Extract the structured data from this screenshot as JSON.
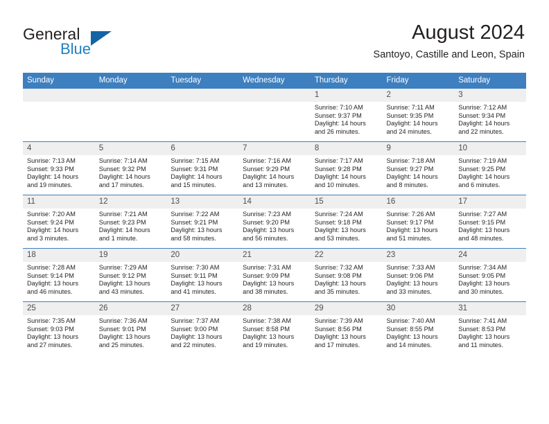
{
  "brand": {
    "name_part1": "General",
    "name_part2": "Blue",
    "logo_icon": "triangle-logo-icon",
    "accent_color": "#1f7fc4",
    "logo_color": "#1464a5"
  },
  "header": {
    "title": "August 2024",
    "location": "Santoyo, Castille and Leon, Spain"
  },
  "calendar": {
    "header_bg": "#3d7fbf",
    "daynum_bg": "#efefef",
    "weekday_headers": [
      "Sunday",
      "Monday",
      "Tuesday",
      "Wednesday",
      "Thursday",
      "Friday",
      "Saturday"
    ],
    "weeks": [
      [
        {
          "day": "",
          "sunrise": "",
          "sunset": "",
          "daylight_line1": "",
          "daylight_line2": ""
        },
        {
          "day": "",
          "sunrise": "",
          "sunset": "",
          "daylight_line1": "",
          "daylight_line2": ""
        },
        {
          "day": "",
          "sunrise": "",
          "sunset": "",
          "daylight_line1": "",
          "daylight_line2": ""
        },
        {
          "day": "",
          "sunrise": "",
          "sunset": "",
          "daylight_line1": "",
          "daylight_line2": ""
        },
        {
          "day": "1",
          "sunrise": "Sunrise: 7:10 AM",
          "sunset": "Sunset: 9:37 PM",
          "daylight_line1": "Daylight: 14 hours",
          "daylight_line2": "and 26 minutes."
        },
        {
          "day": "2",
          "sunrise": "Sunrise: 7:11 AM",
          "sunset": "Sunset: 9:35 PM",
          "daylight_line1": "Daylight: 14 hours",
          "daylight_line2": "and 24 minutes."
        },
        {
          "day": "3",
          "sunrise": "Sunrise: 7:12 AM",
          "sunset": "Sunset: 9:34 PM",
          "daylight_line1": "Daylight: 14 hours",
          "daylight_line2": "and 22 minutes."
        }
      ],
      [
        {
          "day": "4",
          "sunrise": "Sunrise: 7:13 AM",
          "sunset": "Sunset: 9:33 PM",
          "daylight_line1": "Daylight: 14 hours",
          "daylight_line2": "and 19 minutes."
        },
        {
          "day": "5",
          "sunrise": "Sunrise: 7:14 AM",
          "sunset": "Sunset: 9:32 PM",
          "daylight_line1": "Daylight: 14 hours",
          "daylight_line2": "and 17 minutes."
        },
        {
          "day": "6",
          "sunrise": "Sunrise: 7:15 AM",
          "sunset": "Sunset: 9:31 PM",
          "daylight_line1": "Daylight: 14 hours",
          "daylight_line2": "and 15 minutes."
        },
        {
          "day": "7",
          "sunrise": "Sunrise: 7:16 AM",
          "sunset": "Sunset: 9:29 PM",
          "daylight_line1": "Daylight: 14 hours",
          "daylight_line2": "and 13 minutes."
        },
        {
          "day": "8",
          "sunrise": "Sunrise: 7:17 AM",
          "sunset": "Sunset: 9:28 PM",
          "daylight_line1": "Daylight: 14 hours",
          "daylight_line2": "and 10 minutes."
        },
        {
          "day": "9",
          "sunrise": "Sunrise: 7:18 AM",
          "sunset": "Sunset: 9:27 PM",
          "daylight_line1": "Daylight: 14 hours",
          "daylight_line2": "and 8 minutes."
        },
        {
          "day": "10",
          "sunrise": "Sunrise: 7:19 AM",
          "sunset": "Sunset: 9:25 PM",
          "daylight_line1": "Daylight: 14 hours",
          "daylight_line2": "and 6 minutes."
        }
      ],
      [
        {
          "day": "11",
          "sunrise": "Sunrise: 7:20 AM",
          "sunset": "Sunset: 9:24 PM",
          "daylight_line1": "Daylight: 14 hours",
          "daylight_line2": "and 3 minutes."
        },
        {
          "day": "12",
          "sunrise": "Sunrise: 7:21 AM",
          "sunset": "Sunset: 9:23 PM",
          "daylight_line1": "Daylight: 14 hours",
          "daylight_line2": "and 1 minute."
        },
        {
          "day": "13",
          "sunrise": "Sunrise: 7:22 AM",
          "sunset": "Sunset: 9:21 PM",
          "daylight_line1": "Daylight: 13 hours",
          "daylight_line2": "and 58 minutes."
        },
        {
          "day": "14",
          "sunrise": "Sunrise: 7:23 AM",
          "sunset": "Sunset: 9:20 PM",
          "daylight_line1": "Daylight: 13 hours",
          "daylight_line2": "and 56 minutes."
        },
        {
          "day": "15",
          "sunrise": "Sunrise: 7:24 AM",
          "sunset": "Sunset: 9:18 PM",
          "daylight_line1": "Daylight: 13 hours",
          "daylight_line2": "and 53 minutes."
        },
        {
          "day": "16",
          "sunrise": "Sunrise: 7:26 AM",
          "sunset": "Sunset: 9:17 PM",
          "daylight_line1": "Daylight: 13 hours",
          "daylight_line2": "and 51 minutes."
        },
        {
          "day": "17",
          "sunrise": "Sunrise: 7:27 AM",
          "sunset": "Sunset: 9:15 PM",
          "daylight_line1": "Daylight: 13 hours",
          "daylight_line2": "and 48 minutes."
        }
      ],
      [
        {
          "day": "18",
          "sunrise": "Sunrise: 7:28 AM",
          "sunset": "Sunset: 9:14 PM",
          "daylight_line1": "Daylight: 13 hours",
          "daylight_line2": "and 46 minutes."
        },
        {
          "day": "19",
          "sunrise": "Sunrise: 7:29 AM",
          "sunset": "Sunset: 9:12 PM",
          "daylight_line1": "Daylight: 13 hours",
          "daylight_line2": "and 43 minutes."
        },
        {
          "day": "20",
          "sunrise": "Sunrise: 7:30 AM",
          "sunset": "Sunset: 9:11 PM",
          "daylight_line1": "Daylight: 13 hours",
          "daylight_line2": "and 41 minutes."
        },
        {
          "day": "21",
          "sunrise": "Sunrise: 7:31 AM",
          "sunset": "Sunset: 9:09 PM",
          "daylight_line1": "Daylight: 13 hours",
          "daylight_line2": "and 38 minutes."
        },
        {
          "day": "22",
          "sunrise": "Sunrise: 7:32 AM",
          "sunset": "Sunset: 9:08 PM",
          "daylight_line1": "Daylight: 13 hours",
          "daylight_line2": "and 35 minutes."
        },
        {
          "day": "23",
          "sunrise": "Sunrise: 7:33 AM",
          "sunset": "Sunset: 9:06 PM",
          "daylight_line1": "Daylight: 13 hours",
          "daylight_line2": "and 33 minutes."
        },
        {
          "day": "24",
          "sunrise": "Sunrise: 7:34 AM",
          "sunset": "Sunset: 9:05 PM",
          "daylight_line1": "Daylight: 13 hours",
          "daylight_line2": "and 30 minutes."
        }
      ],
      [
        {
          "day": "25",
          "sunrise": "Sunrise: 7:35 AM",
          "sunset": "Sunset: 9:03 PM",
          "daylight_line1": "Daylight: 13 hours",
          "daylight_line2": "and 27 minutes."
        },
        {
          "day": "26",
          "sunrise": "Sunrise: 7:36 AM",
          "sunset": "Sunset: 9:01 PM",
          "daylight_line1": "Daylight: 13 hours",
          "daylight_line2": "and 25 minutes."
        },
        {
          "day": "27",
          "sunrise": "Sunrise: 7:37 AM",
          "sunset": "Sunset: 9:00 PM",
          "daylight_line1": "Daylight: 13 hours",
          "daylight_line2": "and 22 minutes."
        },
        {
          "day": "28",
          "sunrise": "Sunrise: 7:38 AM",
          "sunset": "Sunset: 8:58 PM",
          "daylight_line1": "Daylight: 13 hours",
          "daylight_line2": "and 19 minutes."
        },
        {
          "day": "29",
          "sunrise": "Sunrise: 7:39 AM",
          "sunset": "Sunset: 8:56 PM",
          "daylight_line1": "Daylight: 13 hours",
          "daylight_line2": "and 17 minutes."
        },
        {
          "day": "30",
          "sunrise": "Sunrise: 7:40 AM",
          "sunset": "Sunset: 8:55 PM",
          "daylight_line1": "Daylight: 13 hours",
          "daylight_line2": "and 14 minutes."
        },
        {
          "day": "31",
          "sunrise": "Sunrise: 7:41 AM",
          "sunset": "Sunset: 8:53 PM",
          "daylight_line1": "Daylight: 13 hours",
          "daylight_line2": "and 11 minutes."
        }
      ]
    ]
  }
}
